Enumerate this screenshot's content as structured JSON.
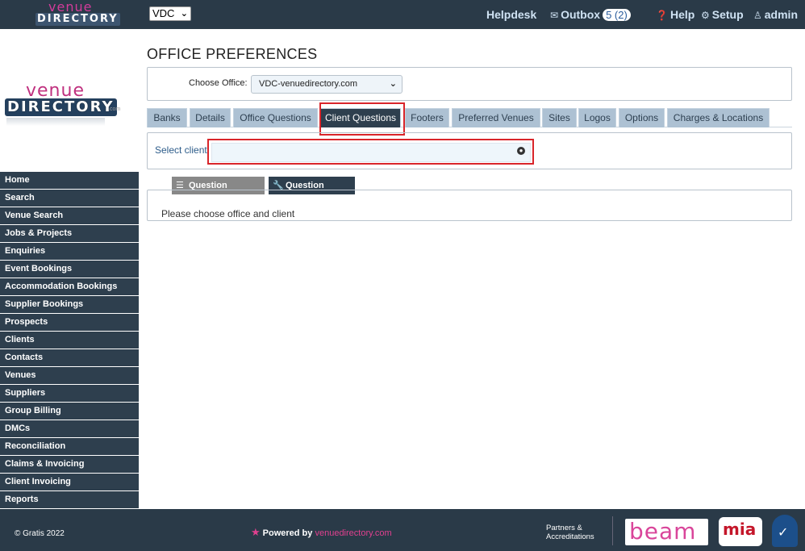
{
  "brand": {
    "logo_top_line": "venue",
    "logo_bottom_line": "DIRECTORY",
    "logo_com": ".com",
    "selector_value": "VDC"
  },
  "topnav": {
    "helpdesk": "Helpdesk",
    "outbox": "Outbox",
    "outbox_badge": "5 (2)",
    "help": "Help",
    "setup": "Setup",
    "user": "admin"
  },
  "sidebar": {
    "items": [
      {
        "label": "Home"
      },
      {
        "label": "Search"
      },
      {
        "label": "Venue Search"
      },
      {
        "label": "Jobs & Projects"
      },
      {
        "label": "Enquiries"
      },
      {
        "label": "Event Bookings"
      },
      {
        "label": "Accommodation Bookings"
      },
      {
        "label": "Supplier Bookings"
      },
      {
        "label": "Prospects"
      },
      {
        "label": "Clients"
      },
      {
        "label": "Contacts"
      },
      {
        "label": "Venues"
      },
      {
        "label": "Suppliers"
      },
      {
        "label": "Group Billing"
      },
      {
        "label": "DMCs"
      },
      {
        "label": "Reconciliation"
      },
      {
        "label": "Claims & Invoicing"
      },
      {
        "label": "Client Invoicing"
      },
      {
        "label": "Reports"
      }
    ]
  },
  "main": {
    "title": "OFFICE PREFERENCES",
    "choose_office_label": "Choose Office:",
    "office_value": "VDC-venuedirectory.com",
    "tabs": [
      {
        "label": "Banks"
      },
      {
        "label": "Details"
      },
      {
        "label": "Office Questions"
      },
      {
        "label": "Client Questions"
      },
      {
        "label": "Footers"
      },
      {
        "label": "Preferred Venues"
      },
      {
        "label": "Sites"
      },
      {
        "label": "Logos"
      },
      {
        "label": "Options"
      },
      {
        "label": "Charges & Locations"
      }
    ],
    "active_tab": "Client Questions",
    "select_client_label": "Select client",
    "client_value": "",
    "subtabs": {
      "question_manager": "Question Manager",
      "question_builder": "Question Builder"
    },
    "message": "Please choose office and client"
  },
  "footer": {
    "copyright": "© Gratis 2022",
    "powered_by": "Powered by",
    "powered_link": "venuedirectory.com",
    "partners_line1": "Partners &",
    "partners_line2": "Accreditations",
    "partner_beam": "beam",
    "partner_mia": "mia"
  },
  "colors": {
    "topbar": "#2a3a48",
    "sidebar_item": "#2e3f4e",
    "tab_inactive": "#adc1d3",
    "tab_active": "#2e3f4e",
    "highlight_outline": "#d9252a",
    "brand_pink": "#e0408f"
  },
  "icons": {
    "outbox": "envelope-icon",
    "help": "question-circle-icon",
    "setup": "gear-icon",
    "user": "user-icon",
    "client_lookup": "globe-icon",
    "question_manager": "list-icon",
    "question_builder": "wrench-icon",
    "powered": "star-icon"
  }
}
